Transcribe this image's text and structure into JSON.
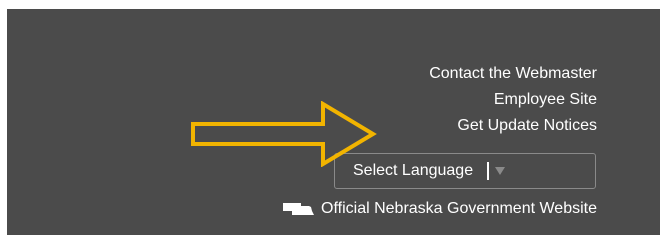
{
  "footer": {
    "links": [
      "Contact the Webmaster",
      "Employee Site",
      "Get Update Notices"
    ],
    "language_select": {
      "label": "Select Language",
      "separator": "|",
      "caret": "▼"
    },
    "official_site": {
      "label": "Official Nebraska Government Website",
      "icon": "nebraska-state-icon"
    }
  },
  "annotation": {
    "arrow_color": "#f2b400",
    "arrow_icon": "right-arrow-icon"
  },
  "colors": {
    "panel_background": "#4b4b4b",
    "text": "#ffffff"
  }
}
